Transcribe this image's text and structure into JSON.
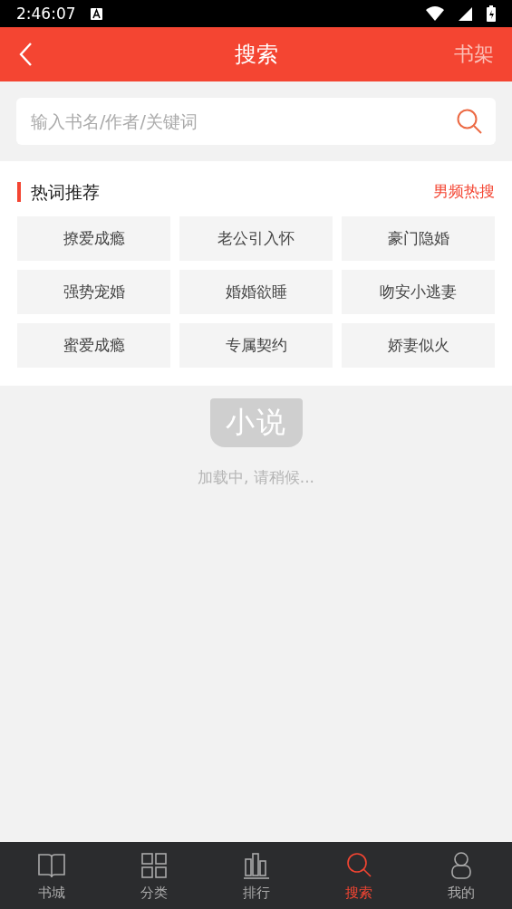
{
  "status_bar": {
    "time": "2:46:07"
  },
  "header": {
    "title": "搜索",
    "action": "书架"
  },
  "search": {
    "placeholder": "输入书名/作者/关键词"
  },
  "hot": {
    "title": "热词推荐",
    "link": "男频热搜",
    "words": [
      "撩爱成瘾",
      "老公引入怀",
      "豪门隐婚",
      "强势宠婚",
      "婚婚欲睡",
      "吻安小逃妻",
      "蜜爱成瘾",
      "专属契约",
      "娇妻似火"
    ]
  },
  "loading": {
    "logo_text": "小说",
    "message": "加载中, 请稍候..."
  },
  "tab_bar": [
    {
      "label": "书城",
      "selected": false
    },
    {
      "label": "分类",
      "selected": false
    },
    {
      "label": "排行",
      "selected": false
    },
    {
      "label": "搜索",
      "selected": true
    },
    {
      "label": "我的",
      "selected": false
    }
  ]
}
